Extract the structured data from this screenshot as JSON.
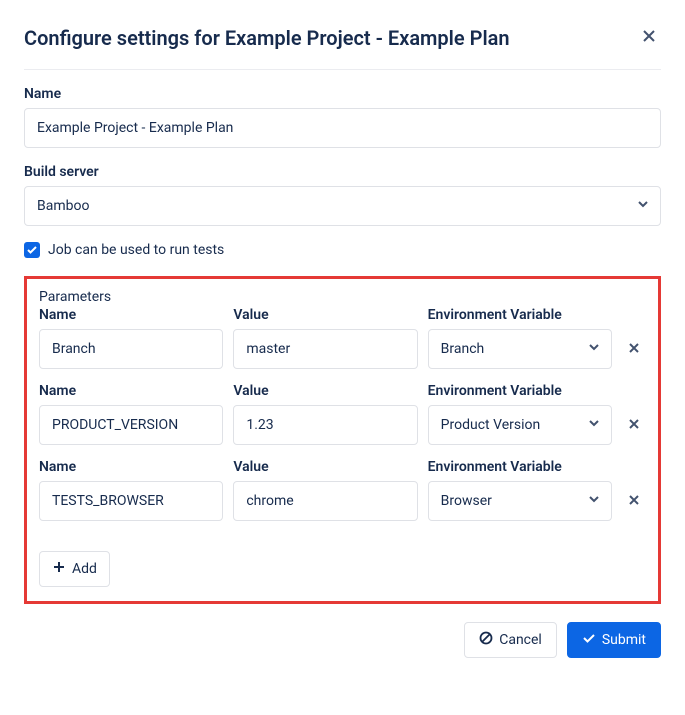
{
  "header": {
    "title": "Configure settings for Example Project - Example Plan"
  },
  "form": {
    "name_label": "Name",
    "name_value": "Example Project - Example Plan",
    "build_server_label": "Build server",
    "build_server_value": "Bamboo",
    "checkbox_label": "Job can be used to run tests",
    "checkbox_checked": true
  },
  "parameters": {
    "section_title": "Parameters",
    "name_header": "Name",
    "value_header": "Value",
    "env_header": "Environment Variable",
    "add_label": "Add",
    "rows": [
      {
        "name": "Branch",
        "value": "master",
        "env": "Branch"
      },
      {
        "name": "PRODUCT_VERSION",
        "value": "1.23",
        "env": "Product Version"
      },
      {
        "name": "TESTS_BROWSER",
        "value": "chrome",
        "env": "Browser"
      }
    ]
  },
  "footer": {
    "cancel": "Cancel",
    "submit": "Submit"
  }
}
